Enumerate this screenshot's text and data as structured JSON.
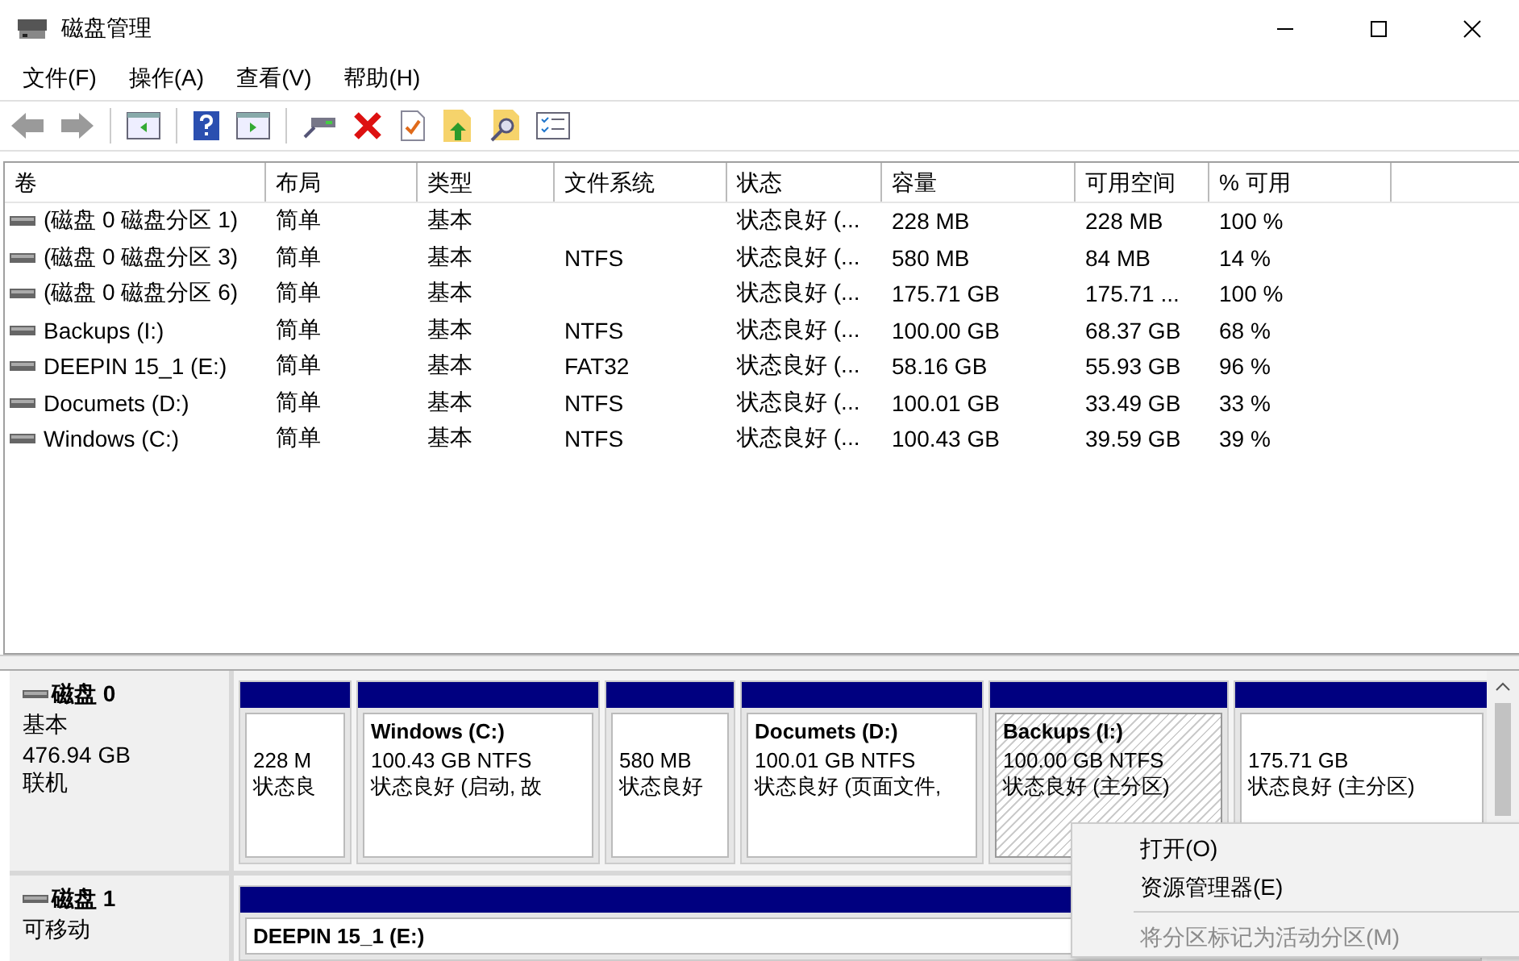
{
  "window": {
    "title": "磁盘管理"
  },
  "menu": [
    {
      "label": "文件(F)"
    },
    {
      "label": "操作(A)"
    },
    {
      "label": "查看(V)"
    },
    {
      "label": "帮助(H)"
    }
  ],
  "toolbar": [
    {
      "kind": "back",
      "disabled": true
    },
    {
      "kind": "forward",
      "disabled": true
    },
    {
      "kind": "sep"
    },
    {
      "kind": "tree"
    },
    {
      "kind": "sep"
    },
    {
      "kind": "help"
    },
    {
      "kind": "pane"
    },
    {
      "kind": "sep"
    },
    {
      "kind": "connect"
    },
    {
      "kind": "delete"
    },
    {
      "kind": "check"
    },
    {
      "kind": "folder-up"
    },
    {
      "kind": "folder-search"
    },
    {
      "kind": "list"
    }
  ],
  "table": {
    "columns": [
      "卷",
      "布局",
      "类型",
      "文件系统",
      "状态",
      "容量",
      "可用空间",
      "% 可用"
    ],
    "rows": [
      [
        "(磁盘 0 磁盘分区 1)",
        "简单",
        "基本",
        "",
        "状态良好 (...",
        "228 MB",
        "228 MB",
        "100 %"
      ],
      [
        "(磁盘 0 磁盘分区 3)",
        "简单",
        "基本",
        "NTFS",
        "状态良好 (...",
        "580 MB",
        "84 MB",
        "14 %"
      ],
      [
        "(磁盘 0 磁盘分区 6)",
        "简单",
        "基本",
        "",
        "状态良好 (...",
        "175.71 GB",
        "175.71 ...",
        "100 %"
      ],
      [
        "Backups (I:)",
        "简单",
        "基本",
        "NTFS",
        "状态良好 (...",
        "100.00 GB",
        "68.37 GB",
        "68 %"
      ],
      [
        "DEEPIN 15_1 (E:)",
        "简单",
        "基本",
        "FAT32",
        "状态良好 (...",
        "58.16 GB",
        "55.93 GB",
        "96 %"
      ],
      [
        "Documets (D:)",
        "简单",
        "基本",
        "NTFS",
        "状态良好 (...",
        "100.01 GB",
        "33.49 GB",
        "33 %"
      ],
      [
        "Windows (C:)",
        "简单",
        "基本",
        "NTFS",
        "状态良好 (...",
        "100.43 GB",
        "39.59 GB",
        "39 %"
      ]
    ]
  },
  "disks": [
    {
      "name": "磁盘 0",
      "details": [
        "基本",
        "476.94 GB",
        "联机"
      ],
      "partitions": [
        {
          "size": "228 M",
          "status": "状态良",
          "selected": false
        },
        {
          "name": "Windows (C:)",
          "size": "100.43 GB NTFS",
          "status": "状态良好 (启动, 故",
          "selected": false
        },
        {
          "size": "580 MB",
          "status": "状态良好",
          "selected": false
        },
        {
          "name": "Documets (D:)",
          "size": "100.01 GB NTFS",
          "status": "状态良好 (页面文件,",
          "selected": false
        },
        {
          "name": "Backups (I:)",
          "size": "100.00 GB NTFS",
          "status": "状态良好 (主分区)",
          "selected": true
        },
        {
          "size": "175.71 GB",
          "status": "状态良好 (主分区)",
          "selected": false
        }
      ]
    },
    {
      "name": "磁盘 1",
      "details": [
        "可移动"
      ],
      "partitions": [
        {
          "name": "DEEPIN 15_1 (E:)",
          "selected": false
        }
      ]
    }
  ],
  "context_menu": [
    {
      "label": "打开(O)",
      "disabled": false
    },
    {
      "label": "资源管理器(E)",
      "disabled": false
    },
    {
      "kind": "separator"
    },
    {
      "label": "将分区标记为活动分区(M)",
      "disabled": true
    }
  ]
}
